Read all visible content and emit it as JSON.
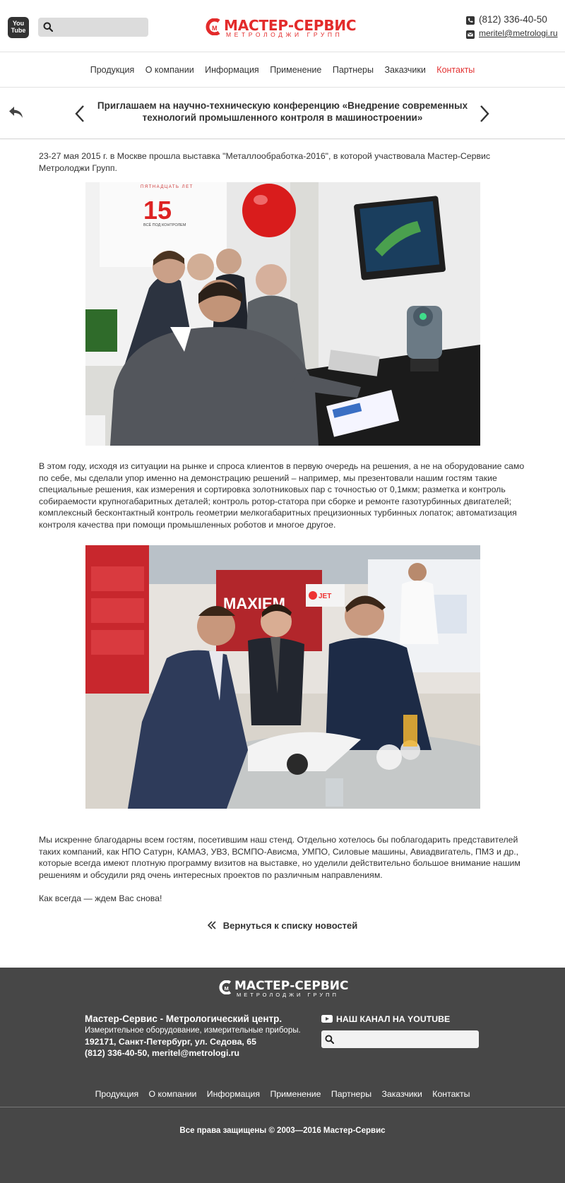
{
  "header": {
    "youtube_logo_text": "You Tube",
    "search_placeholder": "",
    "brand_name": "МАСТЕР-СЕРВИС",
    "brand_sub": "МЕТРОЛОДЖИ ГРУПП",
    "phone": "(812) 336-40-50",
    "email": "meritel@metrologi.ru"
  },
  "nav": {
    "items": [
      "Продукция",
      "О компании",
      "Информация",
      "Применение",
      "Партнеры",
      "Заказчики",
      "Контакты"
    ],
    "active": "Контакты"
  },
  "post": {
    "title": "Приглашаем на научно-техническую конференцию «Внедрение современных технологий промышленного контроля в машиностроении»"
  },
  "article": {
    "p1": "23-27 мая 2015 г. в Москве прошла выставка \"Металлообработка-2016\", в которой участвовала Мастер-Сервис Метролоджи Групп.",
    "p2": "В этом году, исходя из ситуации на рынке и спроса клиентов в первую очередь на решения, а не на оборудование само по себе, мы сделали упор именно на демонстрацию решений – например, мы презентовали нашим гостям такие специальные решения, как измерения и сортировка золотниковых пар с точностью от 0,1мкм; разметка и контроль собираемости крупногабаритных деталей; контроль ротор-статора при сборке и ремонте газотурбинных двигателей; комплексный бесконтактный контроль геометрии мелкогабаритных прецизионных турбинных лопаток; автоматизация контроля качества при помощи промышленных роботов и многое другое.",
    "p3": "Мы искренне благодарны всем гостям, посетившим наш стенд. Отдельно хотелось бы поблагодарить представителей таких компаний, как НПО Сатурн, КАМАЗ, УВЗ, ВСМПО-Ависма, УМПО, Силовые машины, Авиадвигатель, ПМЗ и др., которые всегда имеют плотную программу визитов на выставке, но уделили действительно большое внимание нашим решениям и обсудили ряд очень интересных проектов по различным направлениям.",
    "p4": "Как всегда — ждем Вас снова!",
    "photo1_banner": "ПЯТНАДЦАТЬ ЛЕТ",
    "photo1_number": "15",
    "photo1_caption": "ВСЁ ПОД КОНТРОЛЕМ",
    "photo2_banner": "MAXIEM",
    "photo2_logo": "JET",
    "back_link": "Вернуться к списку новостей"
  },
  "footer": {
    "brand_name": "МАСТЕР-СЕРВИС",
    "brand_sub": "МЕТРОЛОДЖИ ГРУПП",
    "company": "Мастер-Сервис - Метрологический центр.",
    "tagline": "Измерительное оборудование, измерительные приборы.",
    "address": "192171, Санкт-Петербург, ул. Седова, 65",
    "contacts": "(812) 336-40-50, meritel@metrologi.ru",
    "youtube_label": "НАШ КАНАЛ НА YOUTUBE",
    "search_placeholder": "",
    "nav": [
      "Продукция",
      "О компании",
      "Информация",
      "Применение",
      "Партнеры",
      "Заказчики",
      "Контакты"
    ],
    "copyright": "Все права защищены © 2003—2016 Мастер-Сервис"
  },
  "colors": {
    "brand_red": "#e32b2b",
    "active_nav": "#e33333",
    "footer_bg": "#474747",
    "text": "#333333"
  },
  "icons": {
    "youtube": "youtube-icon",
    "search": "search-icon",
    "phone": "phone-icon",
    "email": "envelope-icon",
    "back": "reply-arrow-icon",
    "prev": "chevron-left-icon",
    "next": "chevron-right-icon",
    "back_link": "double-chevron-left-icon"
  }
}
